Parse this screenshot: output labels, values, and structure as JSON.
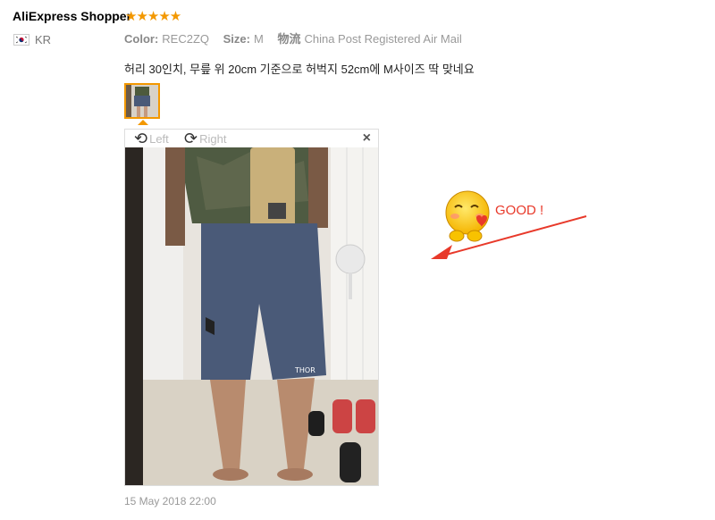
{
  "reviewer": {
    "name": "AliExpress Shopper",
    "rating_stars": "★★★★★",
    "country": "KR"
  },
  "meta": {
    "color_label": "Color:",
    "color_value": "REC2ZQ",
    "size_label": "Size:",
    "size_value": "M",
    "shipping_label": "物流",
    "shipping_value": "China Post Registered Air Mail"
  },
  "review": {
    "text": "허리 30인치, 무릎 위 20cm 기준으로 허벅지 52cm에 M사이즈 딱 맞네요"
  },
  "viewer": {
    "rotate_left_label": "Left",
    "rotate_right_label": "Right",
    "close_symbol": "×"
  },
  "timestamp": "15 May 2018 22:00",
  "annotation": {
    "text": "GOOD !"
  },
  "colors": {
    "accent": "#f39800",
    "annotation": "#e8392a"
  },
  "icons": {
    "rotate_left": "rotate-left-icon",
    "rotate_right": "rotate-right-icon",
    "close": "close-icon",
    "flag": "korea-flag-icon"
  }
}
